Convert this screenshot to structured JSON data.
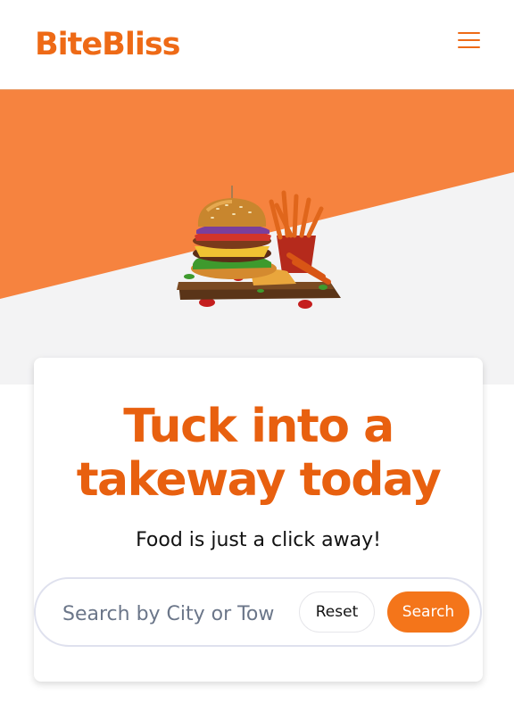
{
  "header": {
    "logo": "BiteBliss",
    "menu_icon": "hamburger-menu-icon"
  },
  "hero": {
    "image": "burger-and-fries-illustration"
  },
  "card": {
    "headline": "Tuck into a takeway today",
    "subtitle": "Food is just a click away!",
    "search": {
      "placeholder": "Search by City or Town",
      "value": "",
      "reset_label": "Reset",
      "search_label": "Search"
    }
  },
  "colors": {
    "brand": "#ee6a16",
    "hero_orange": "#f6833f",
    "hero_gray": "#f3f3f4",
    "search_button": "#f4751a"
  }
}
